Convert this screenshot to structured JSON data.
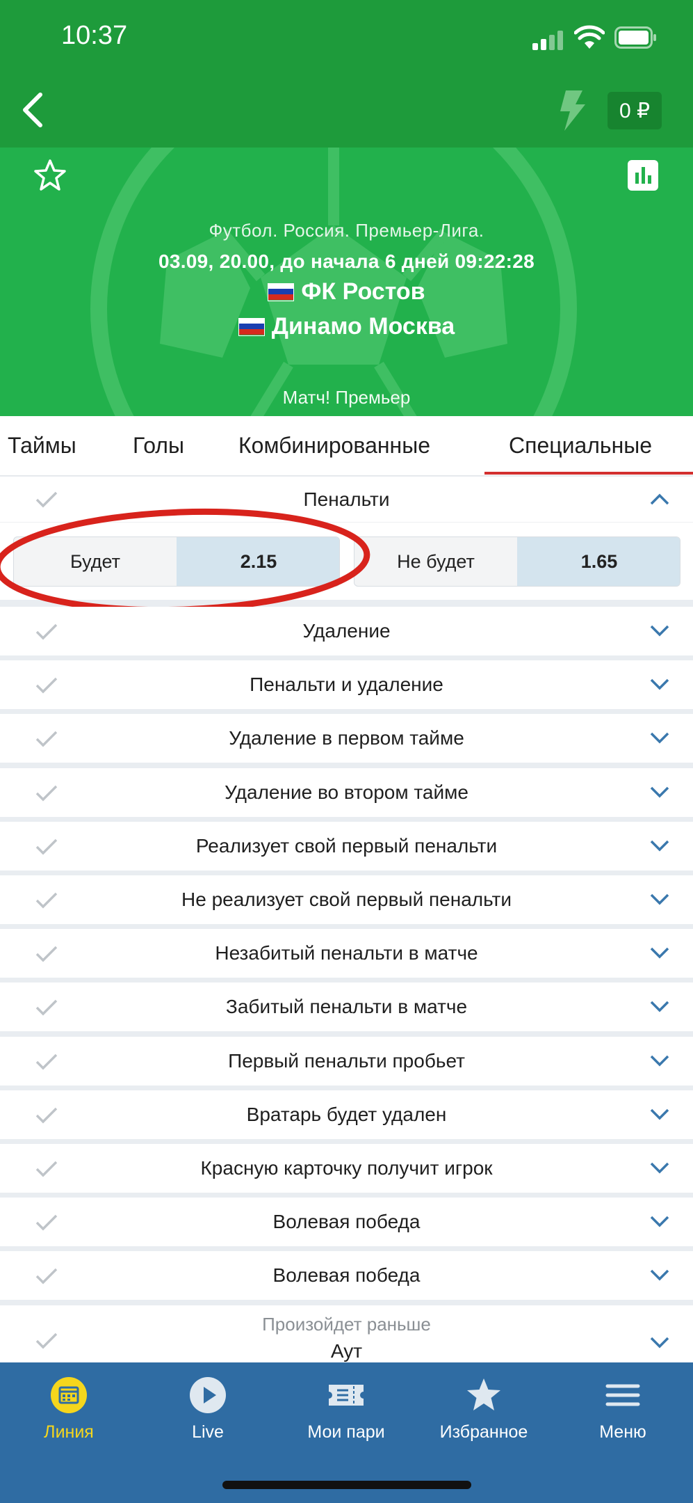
{
  "status_bar": {
    "time": "10:37"
  },
  "nav": {
    "balance": "0 ₽"
  },
  "match": {
    "league": "Футбол. Россия. Премьер-Лига.",
    "datetime": "03.09, 20.00,  до начала 6 дней 09:22:28",
    "team1": "ФК Ростов",
    "team2": "Динамо Москва",
    "channel": "Матч! Премьер"
  },
  "tabs": [
    {
      "label": "Таймы"
    },
    {
      "label": "Голы"
    },
    {
      "label": "Комбинированные"
    },
    {
      "label": "Специальные"
    }
  ],
  "expanded_market": {
    "title": "Пенальти",
    "outcomes": [
      {
        "name": "Будет",
        "odds": "2.15"
      },
      {
        "name": "Не будет",
        "odds": "1.65"
      }
    ]
  },
  "markets": [
    {
      "title": "Удаление"
    },
    {
      "title": "Пенальти и удаление"
    },
    {
      "title": "Удаление в первом тайме"
    },
    {
      "title": "Удаление во втором тайме"
    },
    {
      "title": "Реализует свой первый пенальти"
    },
    {
      "title": "Не реализует свой первый пенальти"
    },
    {
      "title": "Незабитый пенальти в матче"
    },
    {
      "title": "Забитый пенальти в матче"
    },
    {
      "title": "Первый пенальти пробьет"
    },
    {
      "title": "Вратарь будет удален"
    },
    {
      "title": "Красную карточку получит игрок"
    },
    {
      "title": "Волевая победа"
    },
    {
      "title": "Волевая победа"
    }
  ],
  "last_market": {
    "subtitle": "Произойдет раньше",
    "title": "Аут"
  },
  "bottom_nav": [
    {
      "label": "Линия"
    },
    {
      "label": "Live"
    },
    {
      "label": "Мои пари"
    },
    {
      "label": "Избранное"
    },
    {
      "label": "Меню"
    }
  ],
  "colors": {
    "header_green": "#1e9b3b",
    "hero_green": "#22b14c",
    "tab_underline": "#d32f2f",
    "odds_bg": "#d4e4ee",
    "bottom_bar": "#2f6ca3",
    "active_nav": "#f5d61d",
    "chevron": "#3a78ad",
    "annotation_red": "#d8231c"
  }
}
